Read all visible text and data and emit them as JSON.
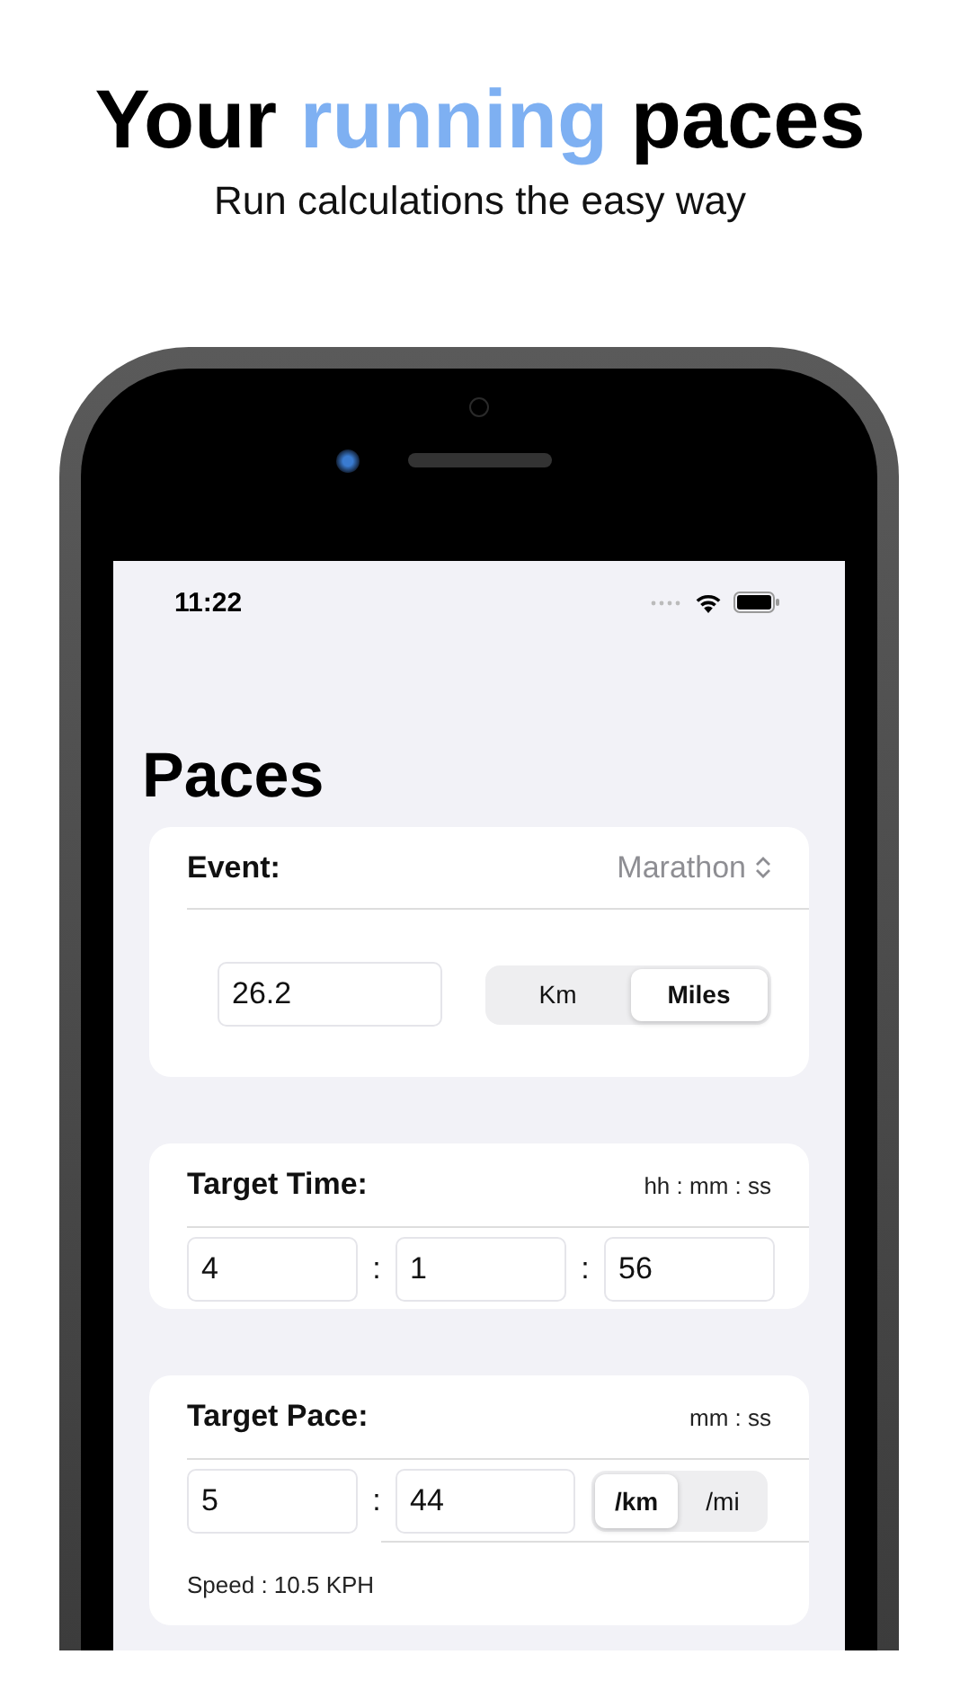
{
  "headline": {
    "parts": [
      {
        "text": "Your ",
        "accent": false
      },
      {
        "text": "running",
        "accent": true
      },
      {
        "text": " paces",
        "accent": false
      }
    ],
    "subtitle": "Run calculations the easy way"
  },
  "status_bar": {
    "time": "11:22"
  },
  "title": "Paces",
  "event_card": {
    "label": "Event:",
    "value": "Marathon",
    "distance": "26.2",
    "units": [
      {
        "label": "Km",
        "selected": false
      },
      {
        "label": "Miles",
        "selected": true
      }
    ]
  },
  "target_time": {
    "label": "Target Time:",
    "format": "hh : mm : ss",
    "items": [
      {
        "kind": "field",
        "text": "4"
      },
      {
        "kind": "separator",
        "text": ":"
      },
      {
        "kind": "field",
        "text": "1"
      },
      {
        "kind": "separator",
        "text": ":"
      },
      {
        "kind": "field",
        "text": "56"
      }
    ]
  },
  "target_pace": {
    "label": "Target Pace:",
    "format": "mm : ss",
    "items": [
      {
        "kind": "field",
        "text": "5"
      },
      {
        "kind": "separator",
        "text": ":"
      },
      {
        "kind": "field",
        "text": "44"
      }
    ],
    "units": [
      {
        "label": "/km",
        "selected": true
      },
      {
        "label": "/mi",
        "selected": false
      }
    ],
    "speed": "Speed : 10.5 KPH"
  }
}
